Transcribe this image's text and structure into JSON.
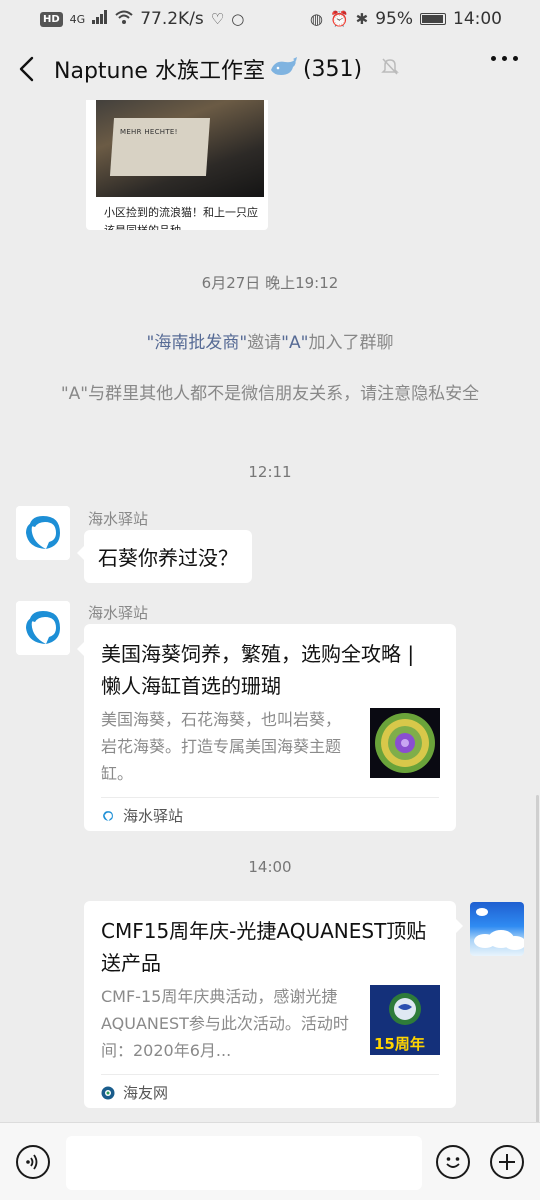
{
  "status_bar": {
    "hd": "HD",
    "net": "4G",
    "speed": "77.2K/s",
    "battery": "95%",
    "time": "14:00"
  },
  "nav": {
    "title": "Naptune 水族工作室",
    "count": "(351)"
  },
  "image_card": {
    "box_label": "MEHR HECHTE!",
    "caption": "小区捡到的流浪猫！和上一只应该是同样的品种"
  },
  "messages": {
    "time1": "6月27日 晚上19:12",
    "system1": {
      "inviter": "\"海南批发商\"",
      "verb": "邀请",
      "invitee": "\"A\"",
      "suffix": "加入了群聊"
    },
    "system2": "\"A\"与群里其他人都不是微信朋友关系，请注意隐私安全",
    "time2": "12:11",
    "msg1": {
      "sender": "海水驿站",
      "text": "石葵你养过没？"
    },
    "msg2": {
      "sender": "海水驿站",
      "title": "美国海葵饲养，繁殖，选购全攻略 | 懒人海缸首选的珊瑚",
      "desc": "美国海葵，石花海葵，也叫岩葵，岩花海葵。打造专属美国海葵主题缸。",
      "source": "海水驿站"
    },
    "time3": "14:00",
    "msg3": {
      "title": "CMF15周年庆-光捷AQUANEST顶贴送产品",
      "desc": "CMF-15周年庆典活动，感谢光捷AQUANEST参与此次活动。活动时间：2020年6月...",
      "thumb_text": "15周年",
      "source": "海友网"
    }
  },
  "input": {
    "placeholder": ""
  }
}
